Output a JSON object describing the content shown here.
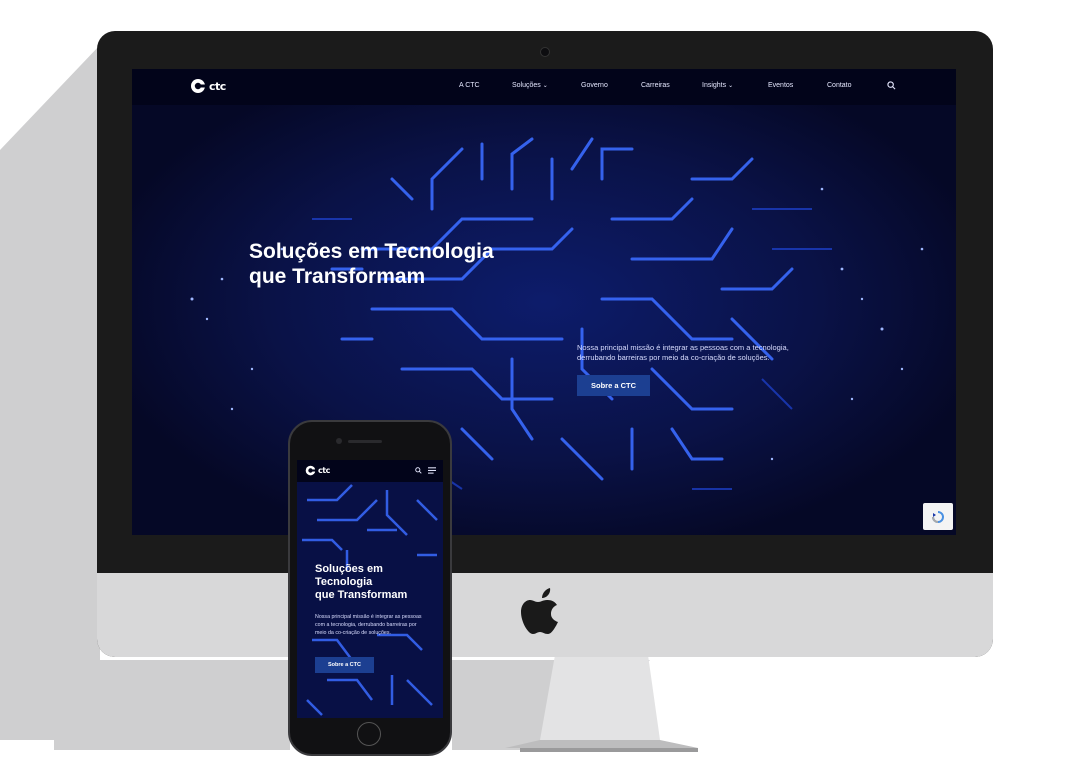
{
  "nav": {
    "logo_text": "ctc",
    "items": [
      {
        "label": "A CTC",
        "has_dropdown": false
      },
      {
        "label": "Soluções",
        "has_dropdown": true
      },
      {
        "label": "Governo",
        "has_dropdown": false
      },
      {
        "label": "Carreiras",
        "has_dropdown": false
      },
      {
        "label": "Insights",
        "has_dropdown": true
      },
      {
        "label": "Eventos",
        "has_dropdown": false
      },
      {
        "label": "Contato",
        "has_dropdown": false
      }
    ],
    "search_icon": "search-icon"
  },
  "hero": {
    "title_line1": "Soluções em Tecnologia",
    "title_line2": "que Transformam",
    "subtitle_line1": "Nossa principal missão é integrar as pessoas com a tecnologia,",
    "subtitle_line2": "derrubando barreiras por meio da co-criação de soluções.",
    "button_label": "Sobre a CTC"
  },
  "mobile": {
    "logo_text": "ctc",
    "title_line1": "Soluções em",
    "title_line2": "Tecnologia",
    "title_line3": "que Transformam",
    "subtitle": "Nossa principal missão é integrar as pessoas com a tecnologia, derrubando barreiras por meio da co-criação de soluções.",
    "button_label": "Sobre a CTC"
  },
  "colors": {
    "accent": "#1c3f91",
    "background": "#070b2a",
    "circuit": "#2f5bff"
  }
}
